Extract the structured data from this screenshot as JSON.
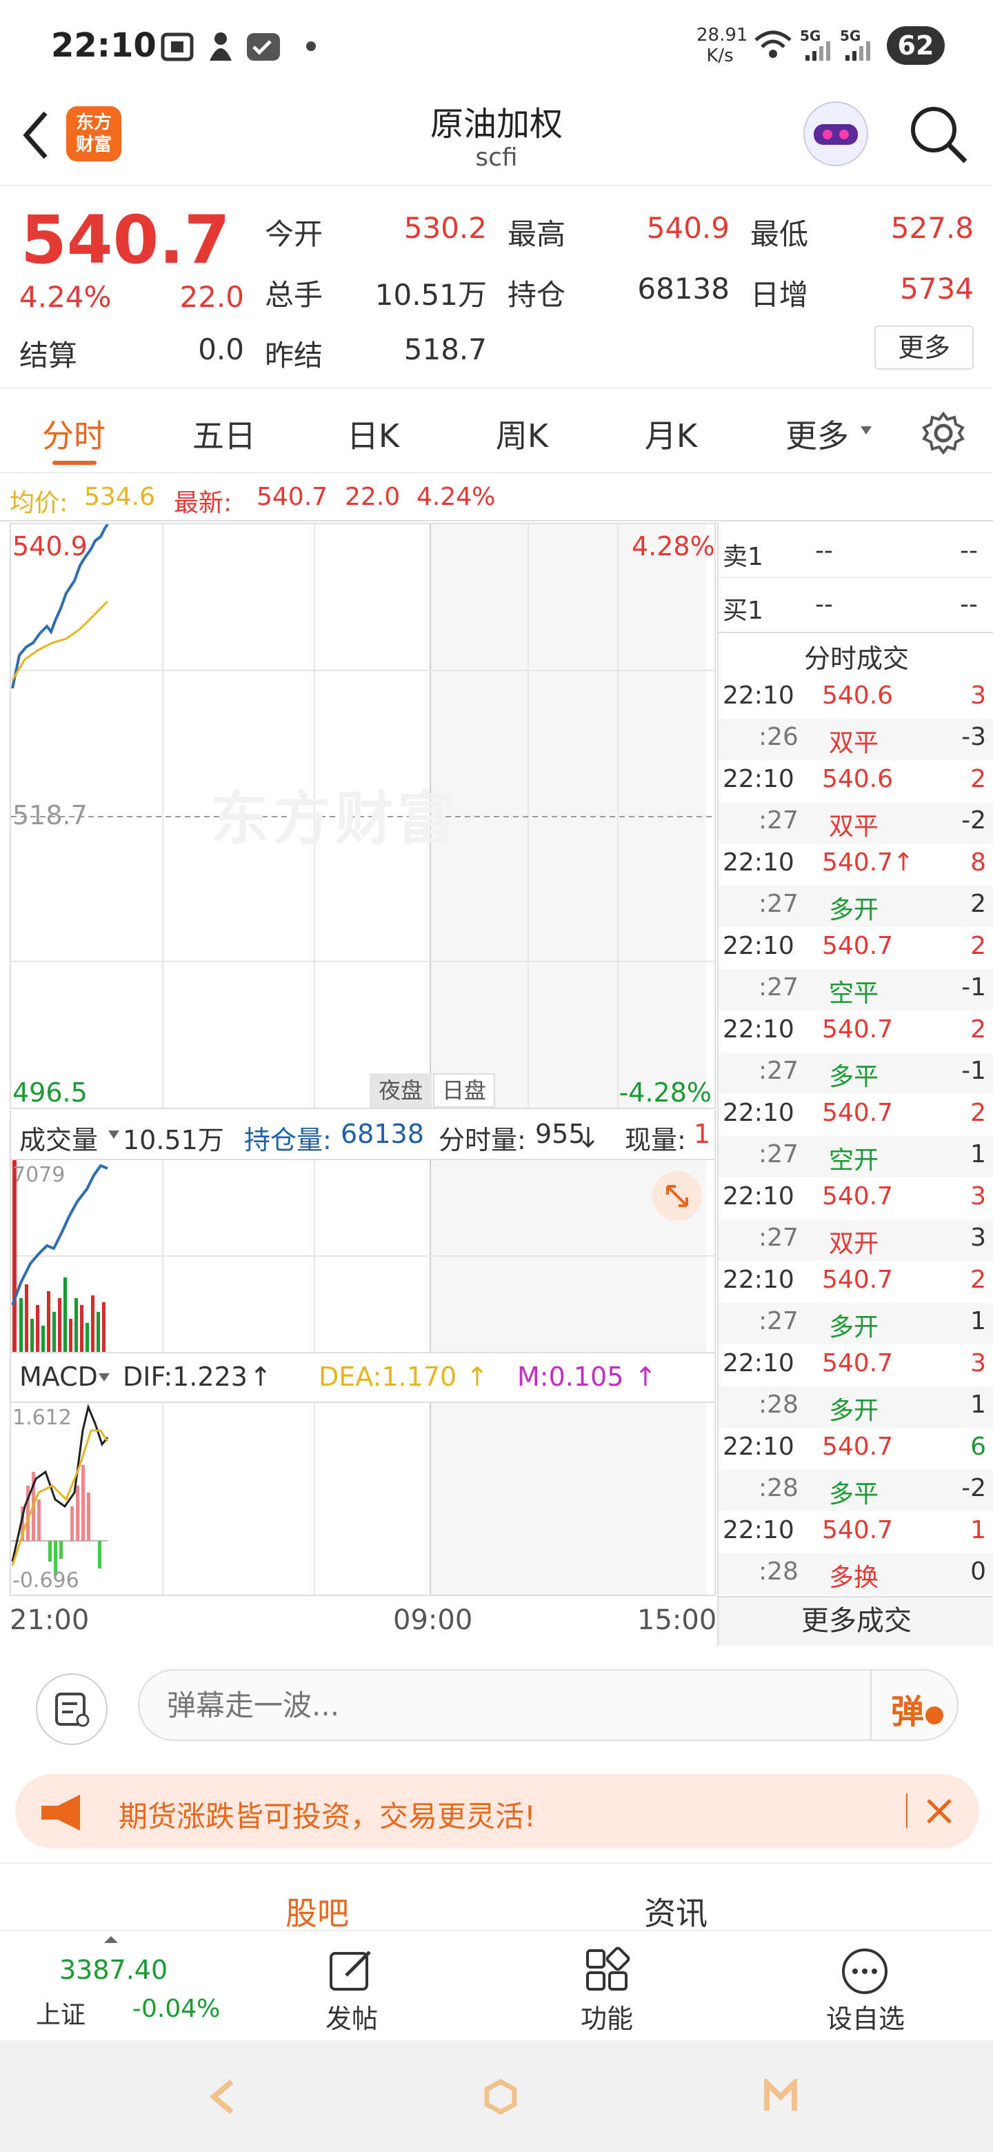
{
  "status": {
    "time": "22:10",
    "speed_top": "28.91",
    "speed_bot": "K/s",
    "net1": "5G",
    "net2": "5G",
    "battery": "62"
  },
  "nav": {
    "logo_line1": "东方",
    "logo_line2": "财富",
    "title": "原油加权",
    "code": "scfi"
  },
  "quote": {
    "price": "540.7",
    "pct": "4.24%",
    "chg": "22.0",
    "open_l": "今开",
    "open": "530.2",
    "high_l": "最高",
    "high": "540.9",
    "low_l": "最低",
    "low": "527.8",
    "vol_l": "总手",
    "vol": "10.51万",
    "oi_l": "持仓",
    "oi": "68138",
    "day_l": "日增",
    "day": "5734",
    "settle_l": "结算",
    "settle": "0.0",
    "prev_l": "昨结",
    "prev": "518.7",
    "more": "更多"
  },
  "tabs": {
    "t1": "分时",
    "t2": "五日",
    "t3": "日K",
    "t4": "周K",
    "t5": "月K",
    "t6": "更多"
  },
  "avg": {
    "avg_l": "均价:",
    "avg": "534.6",
    "last_l": "最新:",
    "last": "540.7",
    "chg": "22.0",
    "pct": "4.24%"
  },
  "main_chart": {
    "top_left": "540.9",
    "top_right": "4.28%",
    "mid": "518.7",
    "bot_left": "496.5",
    "bot_right": "-4.28%",
    "night": "夜盘",
    "day": "日盘",
    "watermark": "东方财富"
  },
  "vol_bar": {
    "sel": "成交量",
    "vol": "10.51万",
    "oi_l": "持仓量:",
    "oi": "68138",
    "tv_l": "分时量:",
    "tv": "955",
    "cur_l": "现量:",
    "cur": "1"
  },
  "vol_chart": {
    "top": "7079"
  },
  "macd_bar": {
    "sel": "MACD",
    "dif": "DIF:1.223",
    "dea": "DEA:1.170",
    "m": "M:0.105"
  },
  "macd_chart": {
    "top": "1.612",
    "bot": "-0.696"
  },
  "xaxis": {
    "a": "21:00",
    "b": "09:00",
    "c": "15:00"
  },
  "orderbook": {
    "sell_l": "卖1",
    "sell_p": "--",
    "sell_q": "--",
    "buy_l": "买1",
    "buy_p": "--",
    "buy_q": "--",
    "title": "分时成交",
    "more": "更多成交"
  },
  "ticks": [
    {
      "t": "22:10",
      "p": "540.6",
      "q": "3",
      "s": ":26",
      "k": "双平",
      "d": "-3"
    },
    {
      "t": "22:10",
      "p": "540.6",
      "q": "2",
      "s": ":27",
      "k": "双平",
      "d": "-2"
    },
    {
      "t": "22:10",
      "p": "540.7↑",
      "q": "8",
      "s": ":27",
      "k": "多开",
      "d": "2"
    },
    {
      "t": "22:10",
      "p": "540.7",
      "q": "2",
      "s": ":27",
      "k": "空平",
      "d": "-1"
    },
    {
      "t": "22:10",
      "p": "540.7",
      "q": "2",
      "s": ":27",
      "k": "多平",
      "d": "-1"
    },
    {
      "t": "22:10",
      "p": "540.7",
      "q": "2",
      "s": ":27",
      "k": "空开",
      "d": "1"
    },
    {
      "t": "22:10",
      "p": "540.7",
      "q": "3",
      "s": ":27",
      "k": "双开",
      "d": "3"
    },
    {
      "t": "22:10",
      "p": "540.7",
      "q": "2",
      "s": ":27",
      "k": "多开",
      "d": "1"
    },
    {
      "t": "22:10",
      "p": "540.7",
      "q": "3",
      "s": ":28",
      "k": "多开",
      "d": "1"
    },
    {
      "t": "22:10",
      "p": "540.7",
      "q": "6",
      "s": ":28",
      "k": "多平",
      "d": "-2"
    },
    {
      "t": "22:10",
      "p": "540.7",
      "q": "1",
      "s": ":28",
      "k": "多换",
      "d": "0"
    }
  ],
  "comment": {
    "placeholder": "弹幕走一波...",
    "dan": "弹"
  },
  "banner": {
    "text": "期货涨跌皆可投资，交易更灵活!"
  },
  "subtabs": {
    "a": "股吧",
    "b": "资讯"
  },
  "bottom": {
    "idx_val": "3387.40",
    "idx_name": "上证",
    "idx_pct": "-0.04%",
    "post": "发帖",
    "func": "功能",
    "fav": "设自选"
  }
}
